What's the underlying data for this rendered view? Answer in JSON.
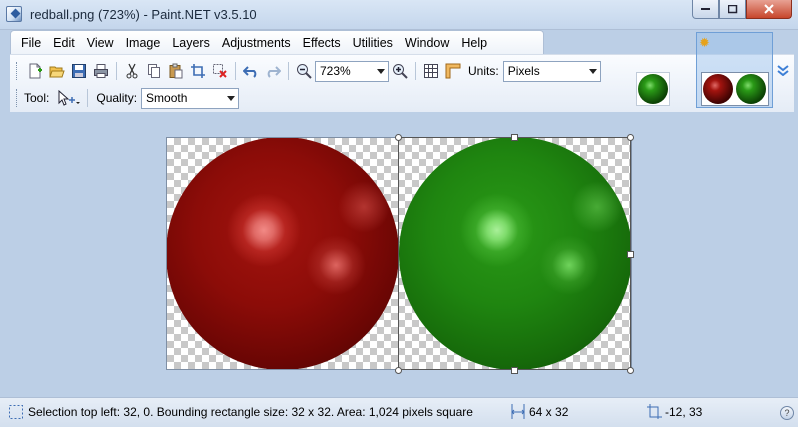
{
  "window": {
    "title": "redball.png (723%) - Paint.NET v3.5.10"
  },
  "menu": {
    "items": [
      {
        "label": "File",
        "key": "file"
      },
      {
        "label": "Edit",
        "key": "edit"
      },
      {
        "label": "View",
        "key": "view"
      },
      {
        "label": "Image",
        "key": "image"
      },
      {
        "label": "Layers",
        "key": "layers"
      },
      {
        "label": "Adjustments",
        "key": "adjustments"
      },
      {
        "label": "Effects",
        "key": "effects"
      },
      {
        "label": "Utilities",
        "key": "utilities"
      },
      {
        "label": "Window",
        "key": "window"
      },
      {
        "label": "Help",
        "key": "help"
      }
    ]
  },
  "toolbar": {
    "zoom_value": "723%",
    "units_label": "Units:",
    "units_value": "Pixels",
    "tool_label": "Tool:",
    "quality_label": "Quality:",
    "quality_value": "Smooth"
  },
  "colors": {
    "red_ball": "#8c0c08",
    "green_ball": "#1f8510",
    "accent": "#6f9fd6"
  },
  "status": {
    "selection_text": "Selection top left: 32, 0. Bounding rectangle size: 32 x 32. Area: 1,024 pixels square",
    "image_size": "64 x 32",
    "cursor_position": "-12, 33"
  }
}
